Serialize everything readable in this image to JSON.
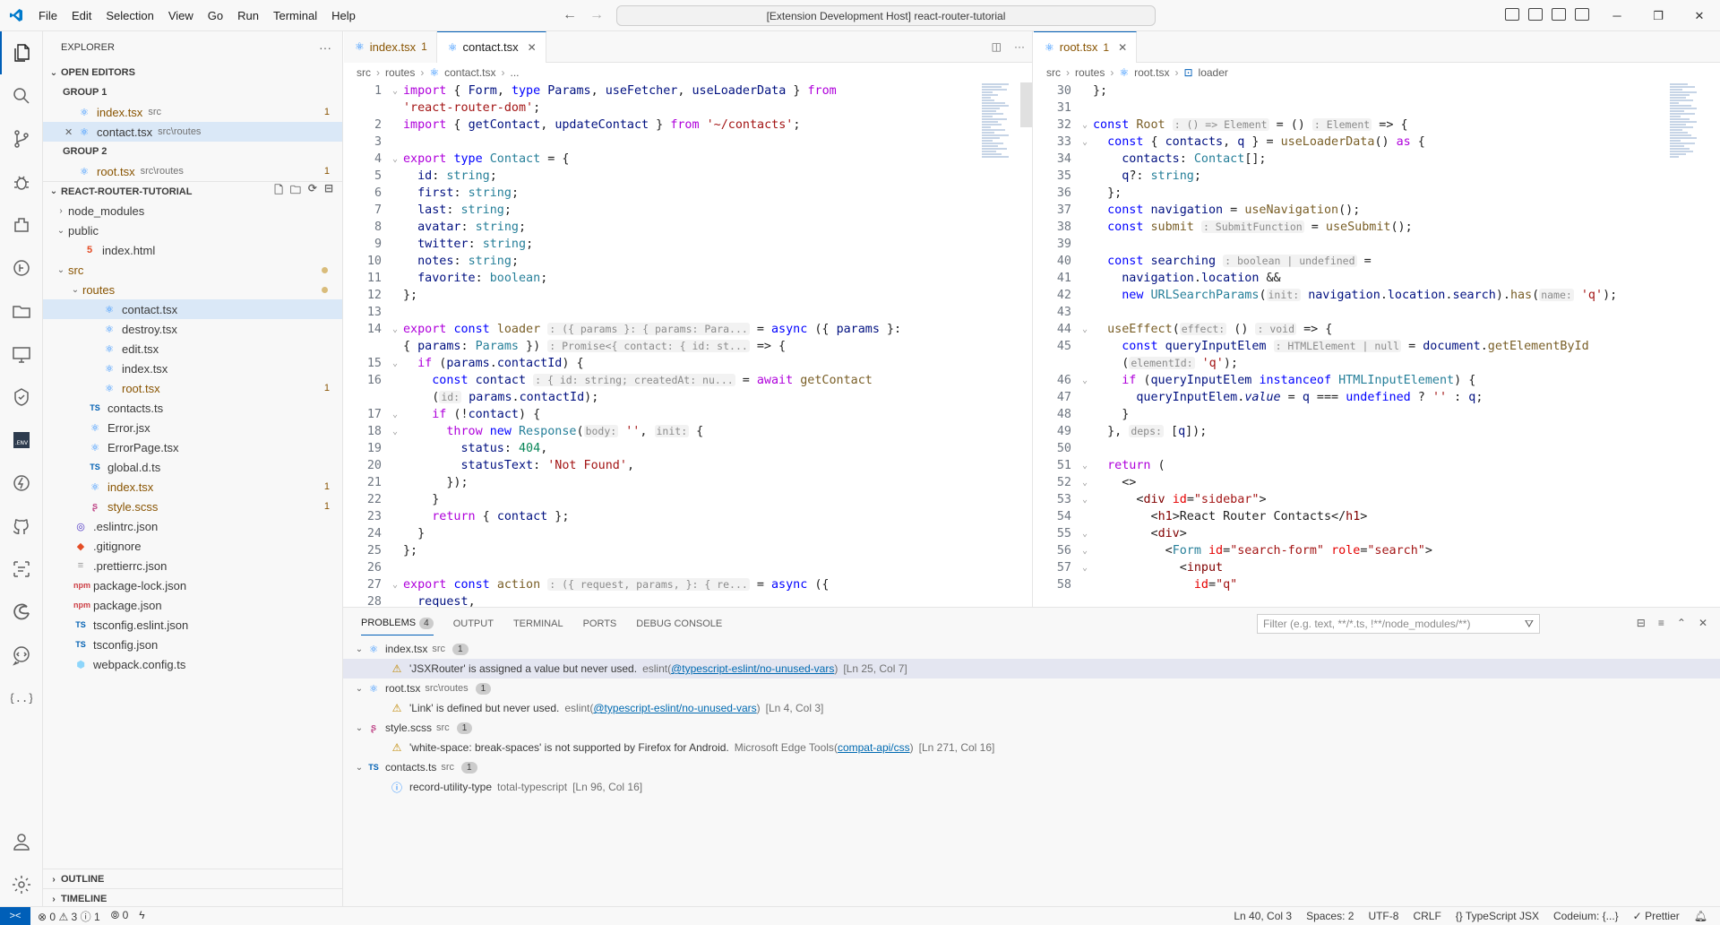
{
  "window": {
    "menu": [
      "File",
      "Edit",
      "Selection",
      "View",
      "Go",
      "Run",
      "Terminal",
      "Help"
    ],
    "title": "[Extension Development Host] react-router-tutorial"
  },
  "sidebar": {
    "title": "EXPLORER",
    "open_editors": {
      "label": "OPEN EDITORS",
      "group1": "GROUP 1",
      "group2": "GROUP 2",
      "g1_items": [
        {
          "name": "index.tsx",
          "desc": "src",
          "badge": "1"
        },
        {
          "name": "contact.tsx",
          "desc": "src\\routes",
          "badge": ""
        }
      ],
      "g2_items": [
        {
          "name": "root.tsx",
          "desc": "src\\routes",
          "badge": "1"
        }
      ]
    },
    "project": {
      "label": "REACT-ROUTER-TUTORIAL",
      "items": [
        {
          "name": "node_modules",
          "badge": ""
        },
        {
          "name": "public",
          "badge": ""
        },
        {
          "name": "index.html",
          "badge": ""
        },
        {
          "name": "src",
          "badge": ""
        },
        {
          "name": "routes",
          "badge": ""
        },
        {
          "name": "contact.tsx",
          "badge": ""
        },
        {
          "name": "destroy.tsx",
          "badge": ""
        },
        {
          "name": "edit.tsx",
          "badge": ""
        },
        {
          "name": "index.tsx",
          "badge": ""
        },
        {
          "name": "root.tsx",
          "badge": "1"
        },
        {
          "name": "contacts.ts",
          "badge": ""
        },
        {
          "name": "Error.jsx",
          "badge": ""
        },
        {
          "name": "ErrorPage.tsx",
          "badge": ""
        },
        {
          "name": "global.d.ts",
          "badge": ""
        },
        {
          "name": "index.tsx",
          "badge": "1"
        },
        {
          "name": "style.scss",
          "badge": "1"
        },
        {
          "name": ".eslintrc.json",
          "badge": ""
        },
        {
          "name": ".gitignore",
          "badge": ""
        },
        {
          "name": ".prettierrc.json",
          "badge": ""
        },
        {
          "name": "package-lock.json",
          "badge": ""
        },
        {
          "name": "package.json",
          "badge": ""
        },
        {
          "name": "tsconfig.eslint.json",
          "badge": ""
        },
        {
          "name": "tsconfig.json",
          "badge": ""
        },
        {
          "name": "webpack.config.ts",
          "badge": ""
        }
      ]
    },
    "outline": "OUTLINE",
    "timeline": "TIMELINE"
  },
  "editor_left": {
    "tabs": [
      {
        "label": "index.tsx",
        "badge": "1"
      },
      {
        "label": "contact.tsx",
        "badge": ""
      }
    ],
    "breadcrumb": [
      "src",
      "routes",
      "contact.tsx",
      "..."
    ]
  },
  "editor_right": {
    "tabs": [
      {
        "label": "root.tsx",
        "badge": "1"
      }
    ],
    "breadcrumb": [
      "src",
      "routes",
      "root.tsx",
      "loader"
    ]
  },
  "panel": {
    "tabs": [
      "PROBLEMS",
      "OUTPUT",
      "TERMINAL",
      "PORTS",
      "DEBUG CONSOLE"
    ],
    "problems_count": "4",
    "filter_placeholder": "Filter (e.g. text, **/*.ts, !**/node_modules/**)",
    "files": [
      {
        "name": "index.tsx",
        "desc": "src",
        "count": "1",
        "msg": "'JSXRouter' is assigned a value but never used.",
        "source": "eslint",
        "code": "@typescript-eslint/no-unused-vars",
        "loc": "[Ln 25, Col 7]"
      },
      {
        "name": "root.tsx",
        "desc": "src\\routes",
        "count": "1",
        "msg": "'Link' is defined but never used.",
        "source": "eslint",
        "code": "@typescript-eslint/no-unused-vars",
        "loc": "[Ln 4, Col 3]"
      },
      {
        "name": "style.scss",
        "desc": "src",
        "count": "1",
        "msg": "'white-space: break-spaces' is not supported by Firefox for Android.",
        "source": "Microsoft Edge Tools",
        "code": "compat-api/css",
        "loc": "[Ln 271, Col 16]"
      },
      {
        "name": "contacts.ts",
        "desc": "src",
        "count": "1",
        "msg": "record-utility-type",
        "source": "total-typescript",
        "code": "",
        "loc": "[Ln 96, Col 16]"
      }
    ]
  },
  "statusbar": {
    "errors": "0",
    "warnings": "3",
    "infos": "1",
    "ports": "0",
    "position": "Ln 40, Col 3",
    "spaces": "Spaces: 2",
    "encoding": "UTF-8",
    "eol": "CRLF",
    "language": "TypeScript JSX",
    "codeium": "Codeium: {...}",
    "prettier": "Prettier"
  }
}
